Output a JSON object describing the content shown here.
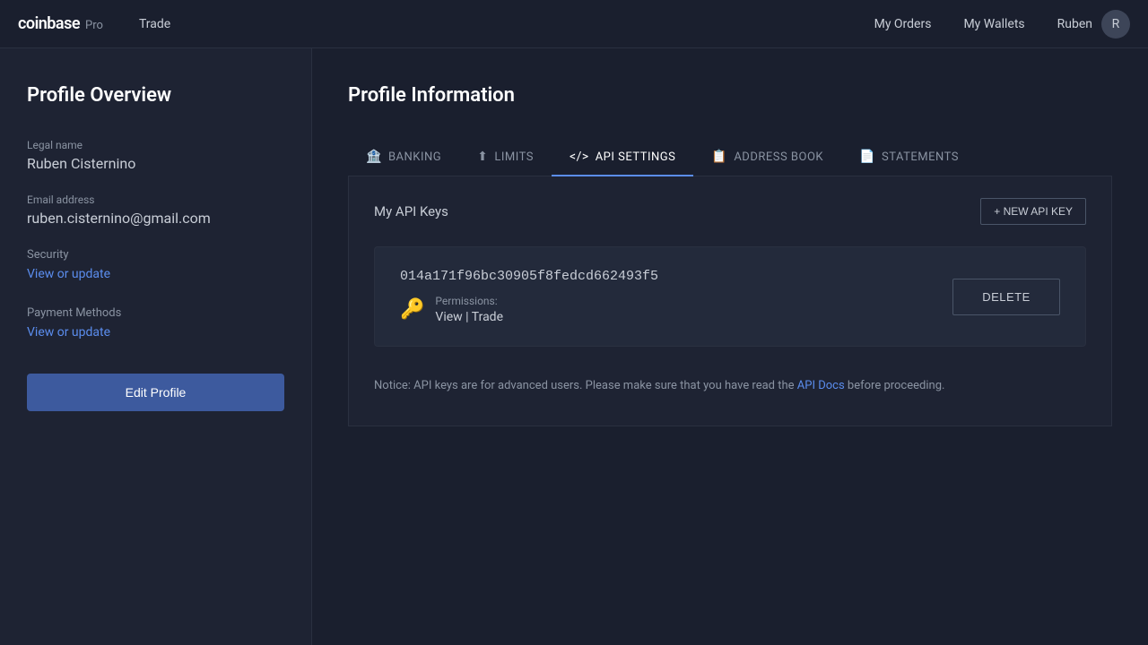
{
  "nav": {
    "logo": "coinbase",
    "pro": "Pro",
    "trade": "Trade",
    "my_orders": "My Orders",
    "my_wallets": "My Wallets",
    "user_name": "Ruben"
  },
  "sidebar": {
    "title": "Profile Overview",
    "legal_name_label": "Legal name",
    "legal_name_value": "Ruben Cisternino",
    "email_label": "Email address",
    "email_value": "ruben.cisternino@gmail.com",
    "security_label": "Security",
    "security_link": "View or update",
    "payment_label": "Payment Methods",
    "payment_link": "View or update",
    "edit_btn": "Edit Profile"
  },
  "content": {
    "title": "Profile Information",
    "tabs": [
      {
        "id": "banking",
        "label": "BANKING",
        "icon": "🏦"
      },
      {
        "id": "limits",
        "label": "LIMITS",
        "icon": "⬆"
      },
      {
        "id": "api_settings",
        "label": "API SETTINGS",
        "icon": "</>"
      },
      {
        "id": "address_book",
        "label": "ADDRESS BOOK",
        "icon": "📋"
      },
      {
        "id": "statements",
        "label": "STATEMENTS",
        "icon": "📄"
      }
    ],
    "active_tab": "api_settings",
    "api_section": {
      "title": "My API Keys",
      "new_api_btn": "+ NEW API KEY",
      "keys": [
        {
          "id": "key1",
          "value": "014a171f96bc30905f8fedcd662493f5",
          "permissions_label": "Permissions:",
          "permissions": "View | Trade",
          "delete_btn": "DELETE"
        }
      ],
      "notice": "Notice: API keys are for advanced users. Please make sure that you have read the ",
      "notice_link": "API Docs",
      "notice_end": " before proceeding."
    }
  }
}
